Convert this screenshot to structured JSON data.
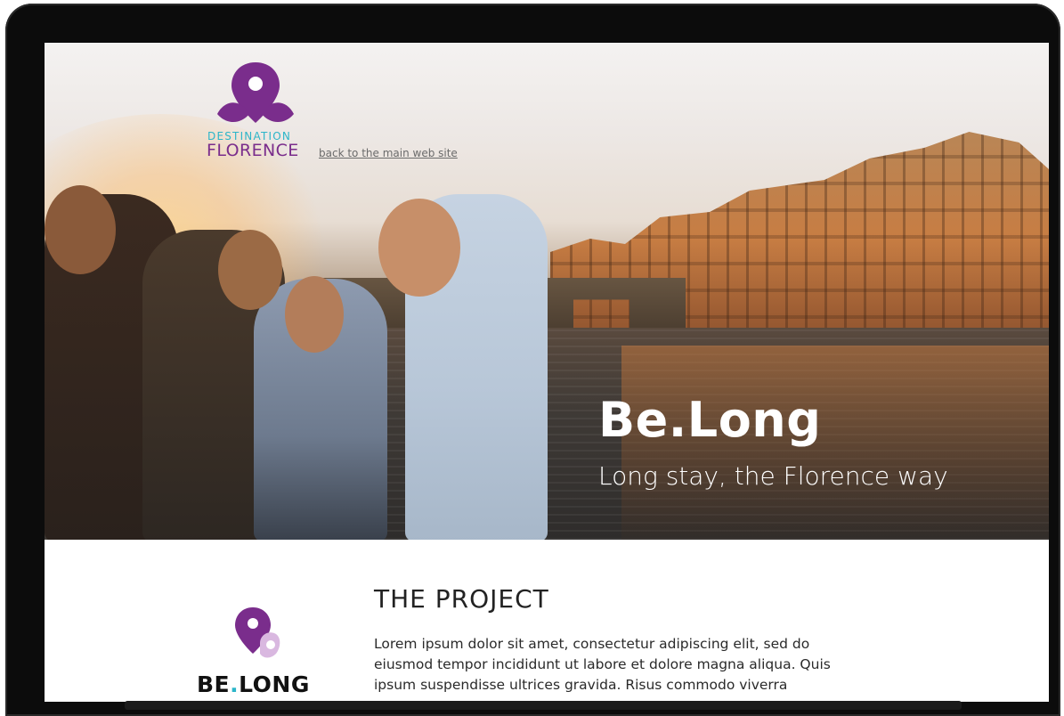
{
  "brand": {
    "line1": "DESTINATION",
    "line2": "FLORENCE",
    "back_link": "back to the main web site",
    "logo_color": "#7a2d8c",
    "accent_color": "#2cb5c9"
  },
  "hero": {
    "title": "Be.Long",
    "subtitle": "Long stay, the Florence way"
  },
  "project": {
    "logo_text_before": "BE",
    "logo_text_dot": ".",
    "logo_text_after": "LONG",
    "title": "THE PROJECT",
    "body": "Lorem ipsum dolor sit amet, consectetur adipiscing elit, sed do eiusmod tempor incididunt ut labore et dolore magna aliqua. Quis ipsum suspendisse ultrices gravida. Risus commodo viverra"
  }
}
